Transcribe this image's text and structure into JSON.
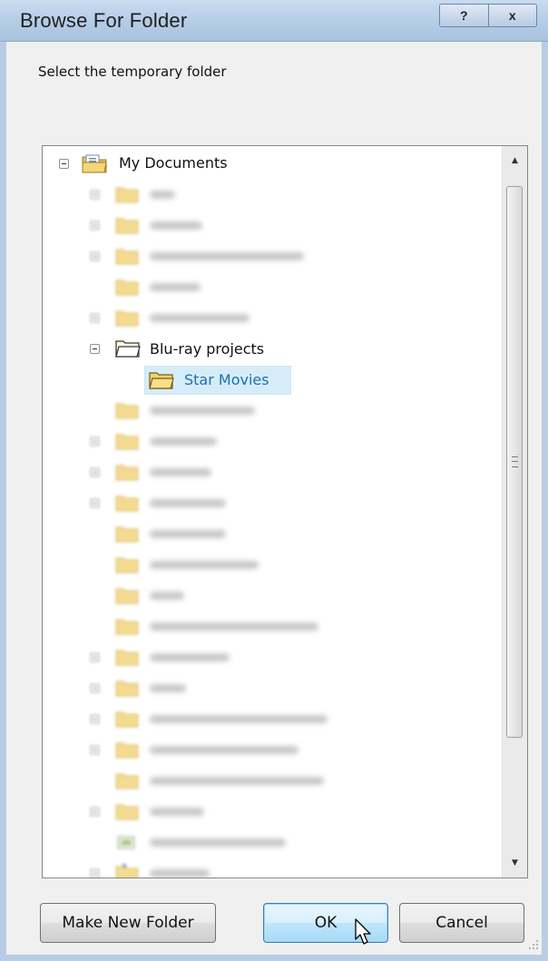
{
  "window": {
    "title": "Browse For Folder",
    "help_label": "?",
    "close_label": "x"
  },
  "prompt": "Select the temporary folder",
  "tree": {
    "root_label": "My Documents",
    "expanded_label": "Blu-ray projects",
    "selected_label": "Star Movies"
  },
  "buttons": {
    "make_new_folder": "Make New Folder",
    "ok": "OK",
    "cancel": "Cancel"
  },
  "colors": {
    "selection": "#d6edf9",
    "title_bar": "#b6cde6",
    "folder": "#f0cf6a"
  }
}
